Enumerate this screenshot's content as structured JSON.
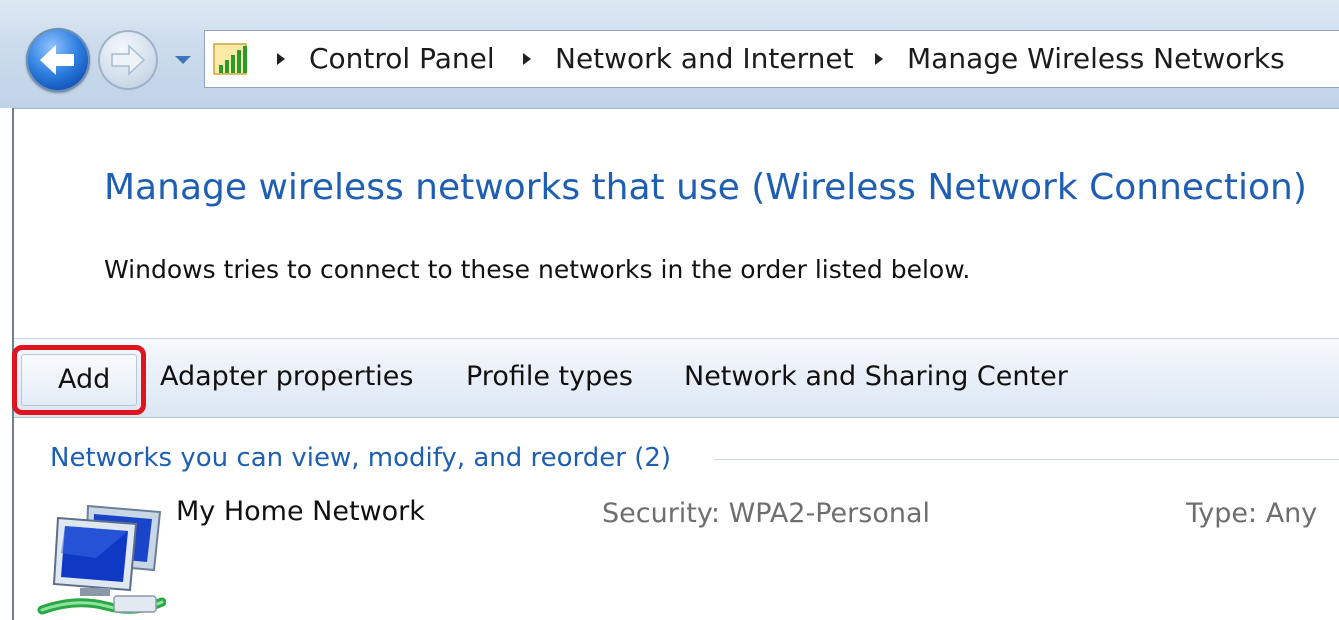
{
  "address_bar": {
    "breadcrumbs": [
      "Control Panel",
      "Network and Internet",
      "Manage Wireless Networks"
    ],
    "location_icon": "network-signal-icon"
  },
  "nav": {
    "back_icon": "back-arrow-icon",
    "forward_icon": "forward-arrow-icon",
    "history_icon": "chevron-down-icon"
  },
  "page": {
    "title": "Manage wireless networks that use (Wireless Network Connection)",
    "description": "Windows tries to connect to these networks in the order listed below."
  },
  "command_bar": {
    "items": [
      "Add",
      "Adapter properties",
      "Profile types",
      "Network and Sharing Center"
    ],
    "highlighted": "Add",
    "highlight_color": "#e0141e"
  },
  "networks_group": {
    "header": "Networks you can view, modify, and reorder (2)",
    "items": [
      {
        "name": "My Home Network",
        "security": "Security:  WPA2-Personal",
        "type": "Type:  Any",
        "icon": "wireless-network-icon"
      }
    ]
  },
  "colors": {
    "title_blue": "#1e5fb3",
    "link_blue": "#1e5fb3"
  }
}
